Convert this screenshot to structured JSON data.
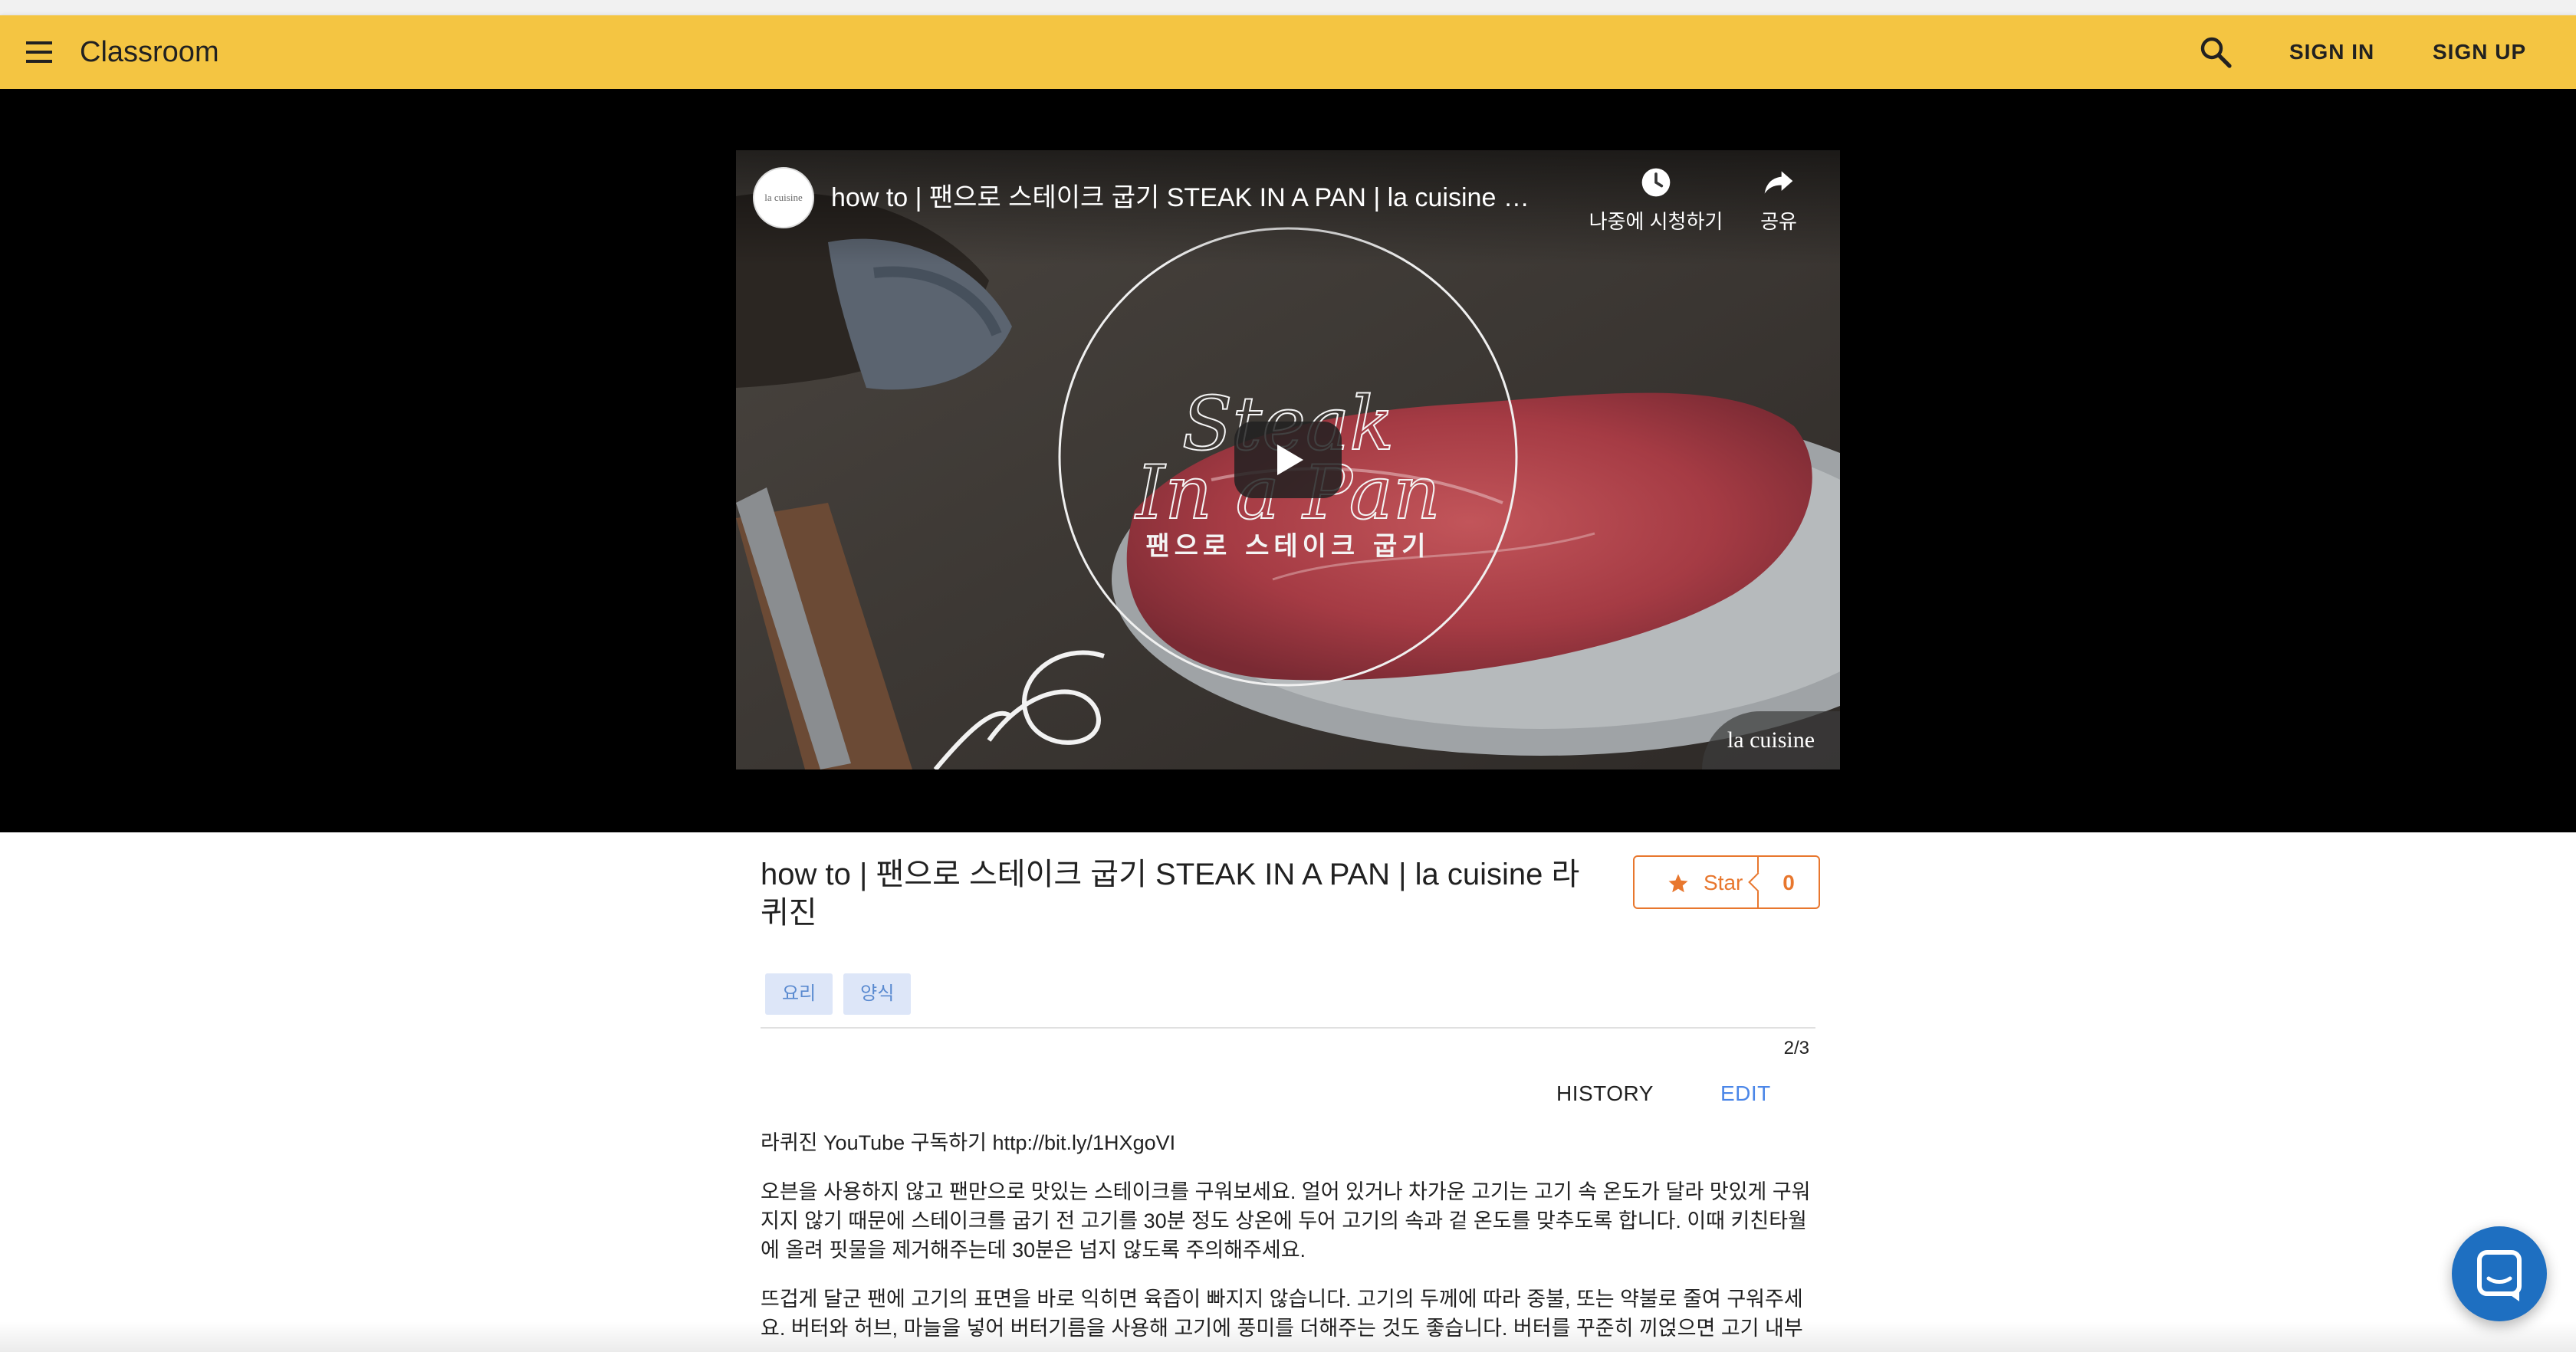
{
  "appbar": {
    "title": "Classroom",
    "sign_in": "SIGN IN",
    "sign_up": "SIGN UP",
    "background_color": "#f4c542",
    "icons": [
      "menu-icon",
      "search-icon"
    ]
  },
  "video": {
    "title": "how to | 팬으로 스테이크 굽기 STEAK IN A PAN | la cuisine 라...",
    "channel_avatar_text": "la cuisine",
    "watch_later": "나중에 시청하기",
    "share": "공유",
    "overlay_line1": "Steak",
    "overlay_line2": "In a Pan",
    "overlay_korean": "팬으로 스테이크 굽기",
    "watermark": "la cuisine",
    "icons": [
      "clock-icon",
      "share-icon",
      "play-icon"
    ]
  },
  "post": {
    "title": "how to | 팬으로 스테이크 굽기 STEAK IN A PAN | la cuisine 라퀴진",
    "star_label": "Star",
    "star_count": "0",
    "star_color": "#e8772e",
    "tags": [
      "요리",
      "양식"
    ],
    "page_indicator": "2/3",
    "history": "HISTORY",
    "edit": "EDIT",
    "edit_color": "#4a86e8",
    "paragraphs": [
      "라퀴진 YouTube 구독하기 http://bit.ly/1HXgoVI",
      "오븐을 사용하지 않고 팬만으로 맛있는 스테이크를 구워보세요. 얼어 있거나 차가운 고기는 고기 속 온도가 달라 맛있게 구워지지 않기 때문에 스테이크를 굽기 전 고기를 30분 정도 상온에 두어 고기의 속과 겉 온도를 맞추도록 합니다. 이때 키친타월에 올려 핏물을 제거해주는데 30분은 넘지 않도록 주의해주세요.",
      "뜨겁게 달군 팬에 고기의 표면을 바로 익히면 육즙이 빠지지 않습니다. 고기의 두께에 따라 중불, 또는 약불로 줄여 구워주세요. 버터와 허브, 마늘을 넣어 버터기름을 사용해 고기에 풍미를 더해주는 것도 좋습니다. 버터를 꾸준히 끼얹으면 고기 내부"
    ]
  },
  "chat": {
    "icon": "chat-icon",
    "color": "#1e6fc1"
  }
}
